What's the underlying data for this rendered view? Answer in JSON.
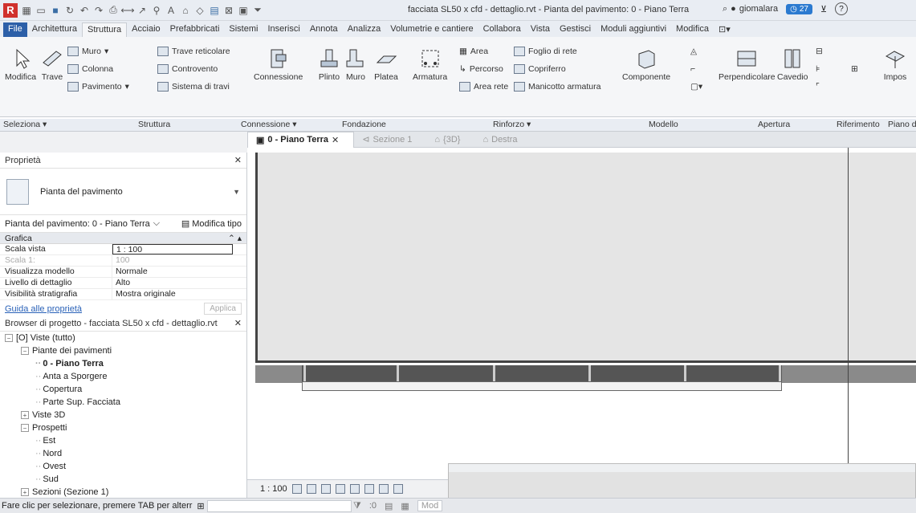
{
  "titlebar": {
    "title": "facciata SL50 x cfd - dettaglio.rvt - Pianta del pavimento: 0 - Piano Terra",
    "user": "giomalara",
    "notifications": "27",
    "help": "?"
  },
  "ribbon_tabs": [
    "File",
    "Architettura",
    "Struttura",
    "Acciaio",
    "Prefabbricati",
    "Sistemi",
    "Inserisci",
    "Annota",
    "Analizza",
    "Volumetrie e cantiere",
    "Collabora",
    "Vista",
    "Gestisci",
    "Moduli aggiuntivi",
    "Modifica"
  ],
  "ribbon": {
    "modifica": "Modifica",
    "trave": "Trave",
    "muro": "Muro",
    "colonna": "Colonna",
    "pavimento": "Pavimento",
    "trave_reticolare": "Trave reticolare",
    "controvento": "Controvento",
    "sistema_di_travi": "Sistema di travi",
    "connessione": "Connessione",
    "plinto": "Plinto",
    "muro_f": "Muro",
    "platea": "Platea",
    "armatura": "Armatura",
    "area": "Area",
    "percorso": "Percorso",
    "area_rete": "Area rete",
    "foglio_di_rete": "Foglio di rete",
    "copriferro": "Copriferro",
    "manicotto_armatura": "Manicotto armatura",
    "componente": "Componente",
    "perpendicolare": "Perpendicolare",
    "cavedio": "Cavedio",
    "impos": "Impos"
  },
  "ribbon_panels": {
    "seleziona": "Seleziona ▾",
    "struttura": "Struttura",
    "connessione": "Connessione ▾",
    "fondazione": "Fondazione",
    "rinforzo": "Rinforzo ▾",
    "modello": "Modello",
    "apertura": "Apertura",
    "riferimento": "Riferimento",
    "piano": "Piano d"
  },
  "properties": {
    "header": "Proprietà",
    "type_name": "Pianta del pavimento",
    "instance": "Pianta del pavimento: 0 - Piano Terra",
    "edit_type": "Modifica tipo",
    "group": "Grafica",
    "rows": [
      {
        "k": "Scala vista",
        "v": "1 : 100"
      },
      {
        "k": "Scala 1:",
        "v": "100"
      },
      {
        "k": "Visualizza modello",
        "v": "Normale"
      },
      {
        "k": "Livello di dettaglio",
        "v": "Alto"
      },
      {
        "k": "Visibilità stratigrafia",
        "v": "Mostra originale"
      }
    ],
    "help_link": "Guida alle proprietà",
    "apply": "Applica"
  },
  "browser": {
    "header": "Browser di progetto - facciata SL50 x cfd - dettaglio.rvt",
    "nodes": [
      "Viste (tutto)",
      "Piante dei pavimenti",
      "0 - Piano Terra",
      "Anta a Sporgere",
      "Copertura",
      "Parte Sup. Facciata",
      "Viste 3D",
      "Prospetti",
      "Est",
      "Nord",
      "Ovest",
      "Sud",
      "Sezioni (Sezione 1)"
    ]
  },
  "view_tabs": [
    "0 - Piano Terra",
    "Sezione 1",
    "{3D}",
    "Destra"
  ],
  "viewbar": {
    "scale": "1 : 100"
  },
  "status": {
    "text": "Fare clic per selezionare, premere TAB per alterr",
    "count": ":0",
    "model": "Mod"
  }
}
